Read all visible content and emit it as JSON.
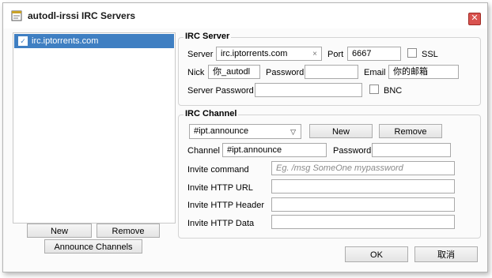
{
  "window": {
    "title": "autodl-irssi IRC Servers",
    "close_symbol": "✕"
  },
  "server_list": {
    "items": [
      {
        "label": "irc.iptorrents.com",
        "checked": true
      }
    ],
    "new_label": "New",
    "remove_label": "Remove",
    "announce_label": "Announce Channels"
  },
  "irc_server": {
    "title": "IRC Server",
    "server_label": "Server",
    "server_value": "irc.iptorrents.com",
    "clear_symbol": "×",
    "port_label": "Port",
    "port_value": "6667",
    "ssl_label": "SSL",
    "nick_label": "Nick",
    "nick_value": "你_autodl",
    "password_label": "Password",
    "password_value": "",
    "email_label": "Email",
    "email_value": "你的邮箱",
    "server_password_label": "Server Password",
    "server_password_value": "",
    "bnc_label": "BNC"
  },
  "irc_channel": {
    "title": "IRC Channel",
    "channel_select_value": "#ipt.announce",
    "new_label": "New",
    "remove_label": "Remove",
    "channel_label": "Channel",
    "channel_value": "#ipt.announce",
    "password_label": "Password",
    "password_value": "",
    "invite_command_label": "Invite command",
    "invite_command_placeholder": "Eg. /msg SomeOne mypassword",
    "invite_http_url_label": "Invite HTTP URL",
    "invite_http_header_label": "Invite HTTP Header",
    "invite_http_data_label": "Invite HTTP Data"
  },
  "footer": {
    "ok_label": "OK",
    "cancel_label": "取消"
  },
  "colors": {
    "selection": "#3f7fc2",
    "close": "#d9534f"
  }
}
